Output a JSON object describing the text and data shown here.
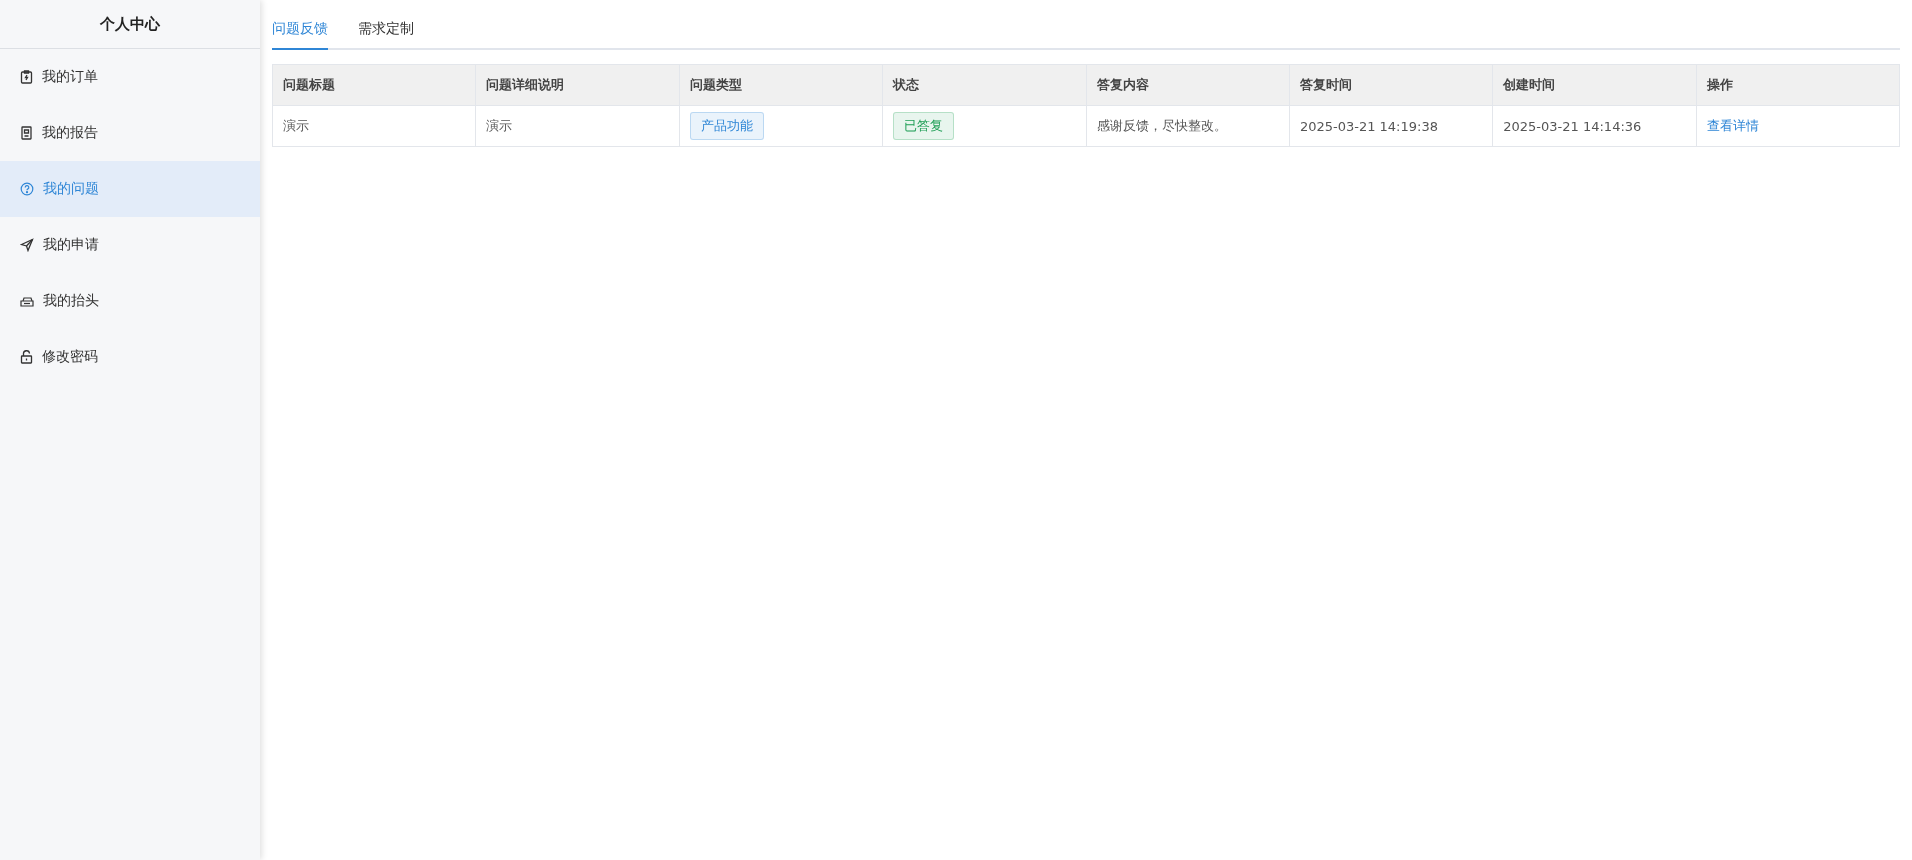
{
  "sidebar": {
    "title": "个人中心",
    "items": [
      {
        "label": "我的订单",
        "selected": false
      },
      {
        "label": "我的报告",
        "selected": false
      },
      {
        "label": "我的问题",
        "selected": true
      },
      {
        "label": "我的申请",
        "selected": false
      },
      {
        "label": "我的抬头",
        "selected": false
      },
      {
        "label": "修改密码",
        "selected": false
      }
    ]
  },
  "tabs": [
    {
      "label": "问题反馈",
      "selected": true
    },
    {
      "label": "需求定制",
      "selected": false
    }
  ],
  "table": {
    "columns": [
      "问题标题",
      "问题详细说明",
      "问题类型",
      "状态",
      "答复内容",
      "答复时间",
      "创建时间",
      "操作"
    ],
    "rows": [
      [
        {
          "kind": "text",
          "text": "演示"
        },
        {
          "kind": "text",
          "text": "演示"
        },
        {
          "kind": "tag",
          "text": "产品功能",
          "color": "#2f86d6"
        },
        {
          "kind": "tag",
          "text": "已答复",
          "color": "#1e9e55"
        },
        {
          "kind": "text",
          "text": "感谢反馈，尽快整改。"
        },
        {
          "kind": "text",
          "text": "2025-03-21 14:19:38"
        },
        {
          "kind": "text",
          "text": "2025-03-21 14:14:36"
        },
        {
          "kind": "link",
          "text": "查看详情"
        }
      ]
    ]
  }
}
